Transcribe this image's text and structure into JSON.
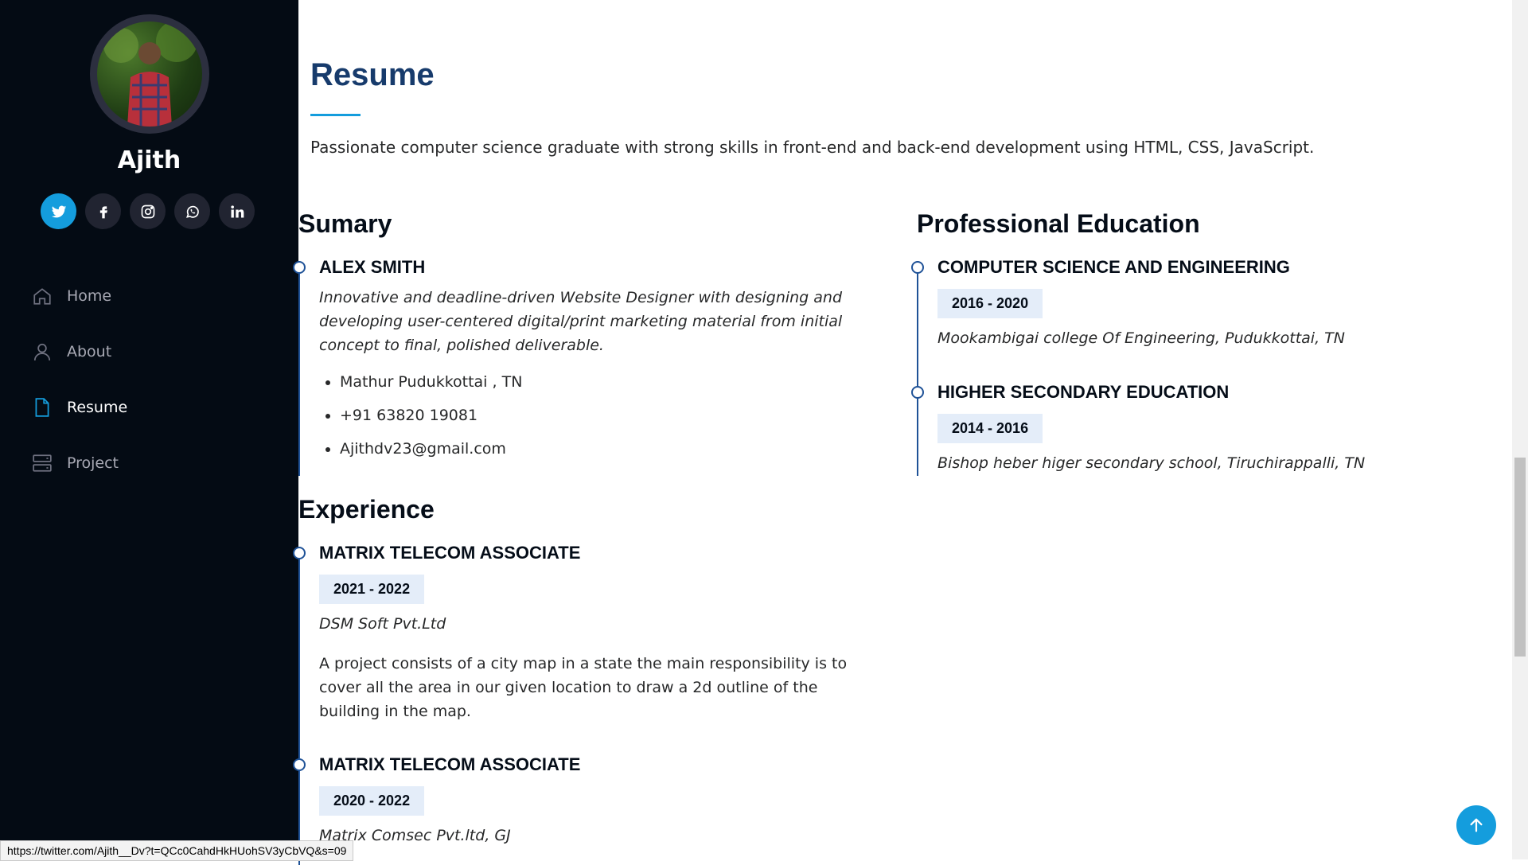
{
  "sidebar": {
    "name": "Ajith",
    "social": [
      {
        "icon": "twitter-icon",
        "glyph": "t",
        "active": true
      },
      {
        "icon": "facebook-icon",
        "glyph": "f"
      },
      {
        "icon": "instagram-icon",
        "glyph": ""
      },
      {
        "icon": "whatsapp-icon",
        "glyph": ""
      },
      {
        "icon": "linkedin-icon",
        "glyph": "in"
      }
    ],
    "nav": [
      {
        "label": "Home",
        "icon": "home-icon"
      },
      {
        "label": "About",
        "icon": "person-icon"
      },
      {
        "label": "Resume",
        "icon": "file-icon",
        "active": true
      },
      {
        "label": "Project",
        "icon": "server-icon"
      }
    ]
  },
  "resume": {
    "title": "Resume",
    "intro": "Passionate computer science graduate with strong skills in front-end and back-end development using HTML, CSS, JavaScript.",
    "summary": {
      "heading": "Sumary",
      "name": "ALEX SMITH",
      "description": "Innovative and deadline-driven Website Designer with designing and developing user-centered digital/print marketing material from initial concept to final, polished deliverable.",
      "contacts": [
        "Mathur Pudukkottai , TN",
        "+91 63820 19081",
        "Ajithdv23@gmail.com"
      ]
    },
    "experience": {
      "heading": "Experience",
      "items": [
        {
          "title": "MATRIX TELECOM ASSOCIATE",
          "dates": "2021 - 2022",
          "company": "DSM Soft Pvt.Ltd",
          "description": "A project consists of a city map in a state the main responsibility is to cover all the area in our given location to draw a 2d outline of the building in the map."
        },
        {
          "title": "MATRIX TELECOM ASSOCIATE",
          "dates": "2020 - 2022",
          "company": "Matrix Comsec Pvt.ltd, GJ"
        }
      ]
    },
    "education": {
      "heading": "Professional Education",
      "items": [
        {
          "title": "COMPUTER SCIENCE AND ENGINEERING",
          "dates": "2016 - 2020",
          "school": "Mookambigai college Of Engineering, Pudukkottai, TN"
        },
        {
          "title": "HIGHER SECONDARY EDUCATION",
          "dates": "2014 - 2016",
          "school": "Bishop heber higer secondary school, Tiruchirappalli, TN"
        }
      ]
    }
  },
  "status_bar": {
    "url": "https://twitter.com/Ajith__Dv?t=QCc0CahdHkHUohSV3yCbVQ&s=09"
  },
  "colors": {
    "sidebar_bg": "#040b14",
    "accent": "#149ddd",
    "title": "#173b6c",
    "timeline": "#1f5297",
    "badge_bg": "#e4edf9"
  }
}
